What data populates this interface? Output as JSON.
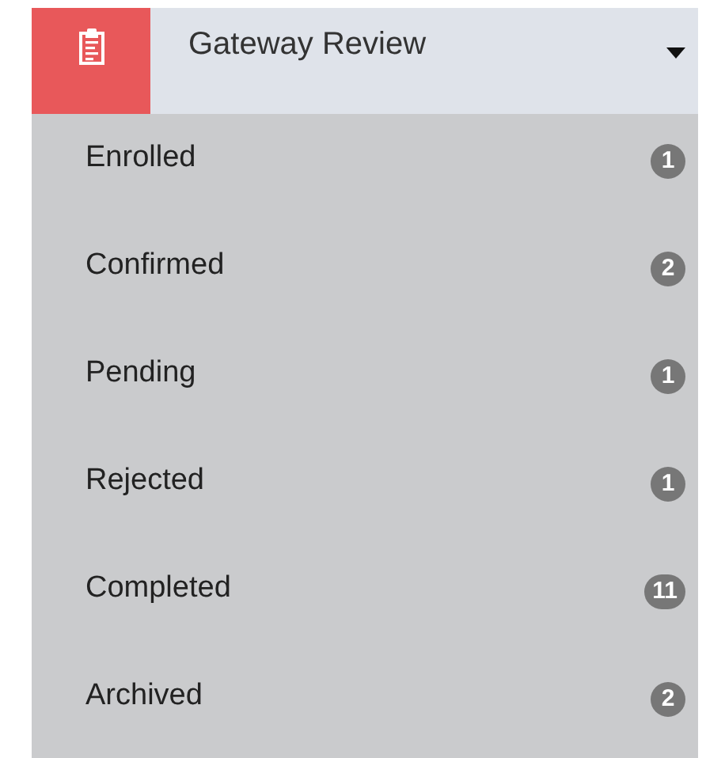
{
  "header": {
    "title": "Gateway Review",
    "expanded": true
  },
  "items": [
    {
      "label": "Enrolled",
      "count": "1"
    },
    {
      "label": "Confirmed",
      "count": "2"
    },
    {
      "label": "Pending",
      "count": "1"
    },
    {
      "label": "Rejected",
      "count": "1"
    },
    {
      "label": "Completed",
      "count": "11"
    },
    {
      "label": "Archived",
      "count": "2"
    }
  ]
}
